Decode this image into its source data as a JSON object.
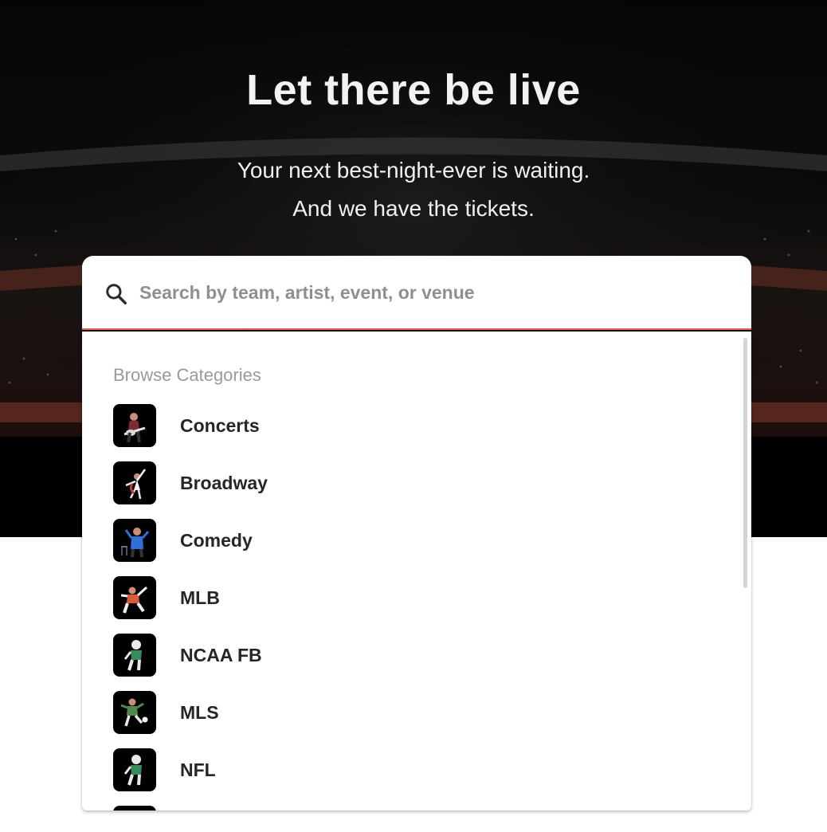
{
  "hero": {
    "title": "Let there be live",
    "subtitle_line1": "Your next best-night-ever is waiting.",
    "subtitle_line2": "And we have the tickets."
  },
  "search": {
    "placeholder": "Search by team, artist, event, or venue",
    "value": "",
    "icon": "search-icon",
    "focus_color": "#e0634f"
  },
  "dropdown": {
    "heading": "Browse Categories",
    "categories": [
      {
        "label": "Concerts",
        "icon": "guitarist-icon"
      },
      {
        "label": "Broadway",
        "icon": "dancer-icon"
      },
      {
        "label": "Comedy",
        "icon": "comedian-icon"
      },
      {
        "label": "MLB",
        "icon": "baseball-player-icon"
      },
      {
        "label": "NCAA FB",
        "icon": "football-player-icon"
      },
      {
        "label": "MLS",
        "icon": "soccer-player-icon"
      },
      {
        "label": "NFL",
        "icon": "football-player-icon"
      }
    ]
  }
}
